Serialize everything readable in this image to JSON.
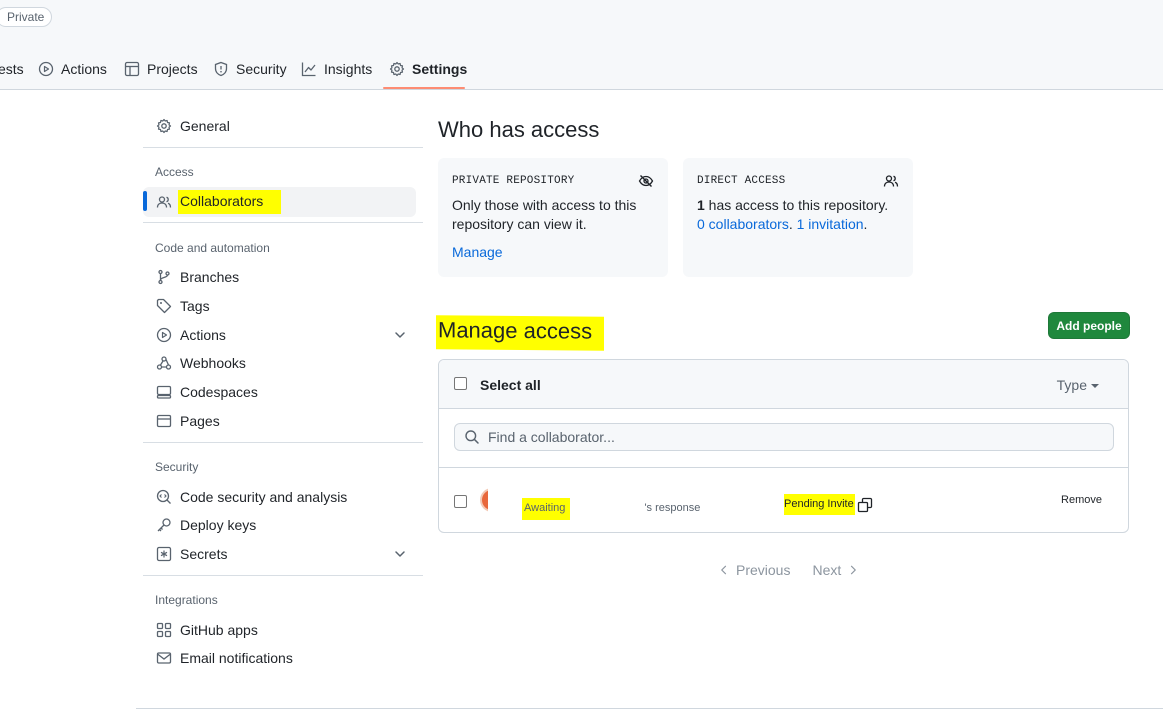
{
  "repo": {
    "visibility_badge": "Private"
  },
  "tabs": [
    {
      "label": "ests",
      "icon": "pull-request-icon"
    },
    {
      "label": "Actions",
      "icon": "play-icon"
    },
    {
      "label": "Projects",
      "icon": "table-icon"
    },
    {
      "label": "Security",
      "icon": "shield-icon"
    },
    {
      "label": "Insights",
      "icon": "graph-icon"
    },
    {
      "label": "Settings",
      "icon": "gear-icon",
      "active": true
    }
  ],
  "sidebar": {
    "general": "General",
    "sections": {
      "access": "Access",
      "code_automation": "Code and automation",
      "security": "Security",
      "integrations": "Integrations"
    },
    "items": {
      "collaborators": "Collaborators",
      "branches": "Branches",
      "tags": "Tags",
      "actions": "Actions",
      "webhooks": "Webhooks",
      "codespaces": "Codespaces",
      "pages": "Pages",
      "code_security": "Code security and analysis",
      "deploy_keys": "Deploy keys",
      "secrets": "Secrets",
      "github_apps": "GitHub apps",
      "email_notifications": "Email notifications"
    }
  },
  "who_has_access": {
    "heading": "Who has access",
    "private_card": {
      "title": "PRIVATE REPOSITORY",
      "text": "Only those with access to this repository can view it.",
      "link": "Manage"
    },
    "direct_card": {
      "title": "DIRECT ACCESS",
      "count": "1",
      "text": " has access to this repository. ",
      "collaborators_link": "0 collaborators",
      "sep": ". ",
      "invitation_link": "1 invitation",
      "end": "."
    }
  },
  "manage_access": {
    "heading": "Manage access",
    "add_button": "Add people",
    "select_all": "Select all",
    "type_filter": "Type",
    "search_placeholder": "Find a collaborator...",
    "rows": [
      {
        "status_prefix": "Awaiting ",
        "status_suffix": "'s response",
        "invite_label": "Pending Invite",
        "remove_label": "Remove"
      }
    ]
  },
  "pagination": {
    "previous": "Previous",
    "next": "Next"
  },
  "colors": {
    "accent": "#0969da",
    "primary_button": "#1f883d",
    "tab_underline": "#fd8c73",
    "highlight": "#ffff00"
  }
}
